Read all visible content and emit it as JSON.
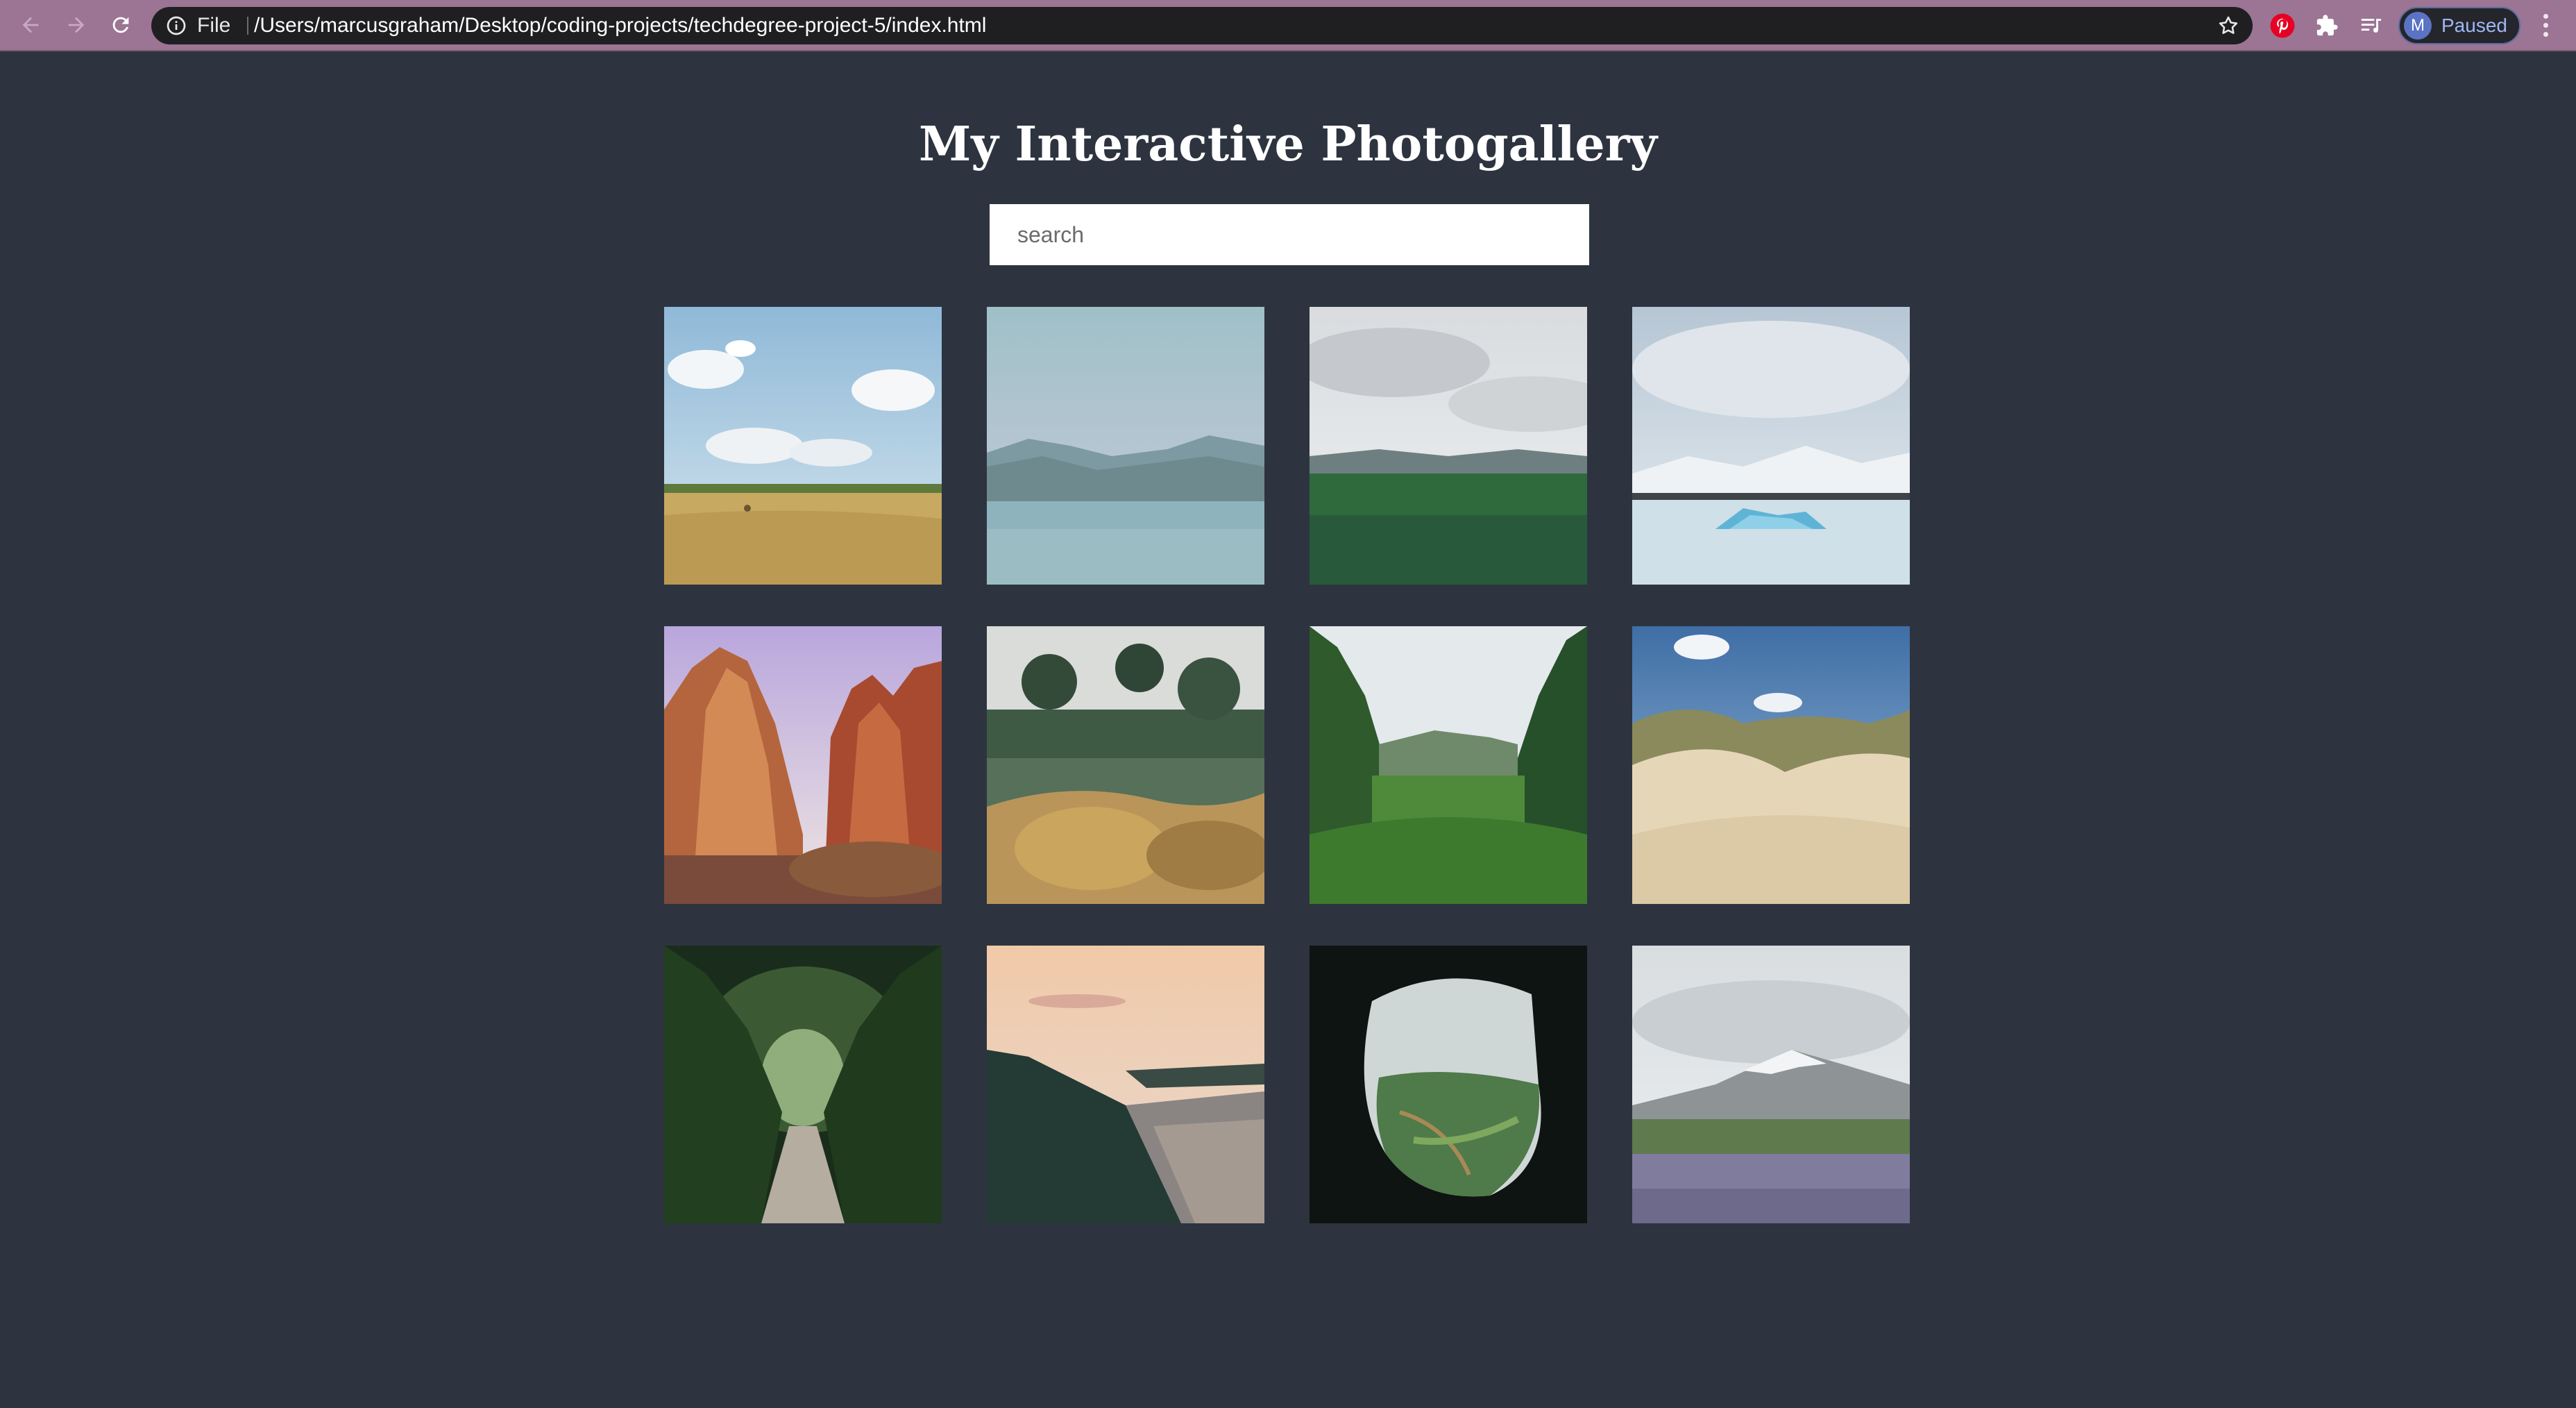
{
  "browser": {
    "scheme_label": "File",
    "url": "/Users/marcusgraham/Desktop/coding-projects/techdegree-project-5/index.html",
    "profile_initial": "M",
    "profile_status": "Paused",
    "chrome_color": "#9c7494"
  },
  "page": {
    "title": "My Interactive Photogallery",
    "background": "#2d3440",
    "search_placeholder": "search"
  },
  "gallery": {
    "photos": [
      {
        "scene": "hay field with clouds"
      },
      {
        "scene": "lake with mountains"
      },
      {
        "scene": "green meadow under overcast sky"
      },
      {
        "scene": "glacier lagoon with icebergs"
      },
      {
        "scene": "red canyon cliffs"
      },
      {
        "scene": "garden with pine trees"
      },
      {
        "scene": "lush green valley"
      },
      {
        "scene": "sand dunes with grass"
      },
      {
        "scene": "tree tunnel path"
      },
      {
        "scene": "coastline at sunset"
      },
      {
        "scene": "cave opening over valley"
      },
      {
        "scene": "snowy mountain with lupine field"
      }
    ]
  }
}
